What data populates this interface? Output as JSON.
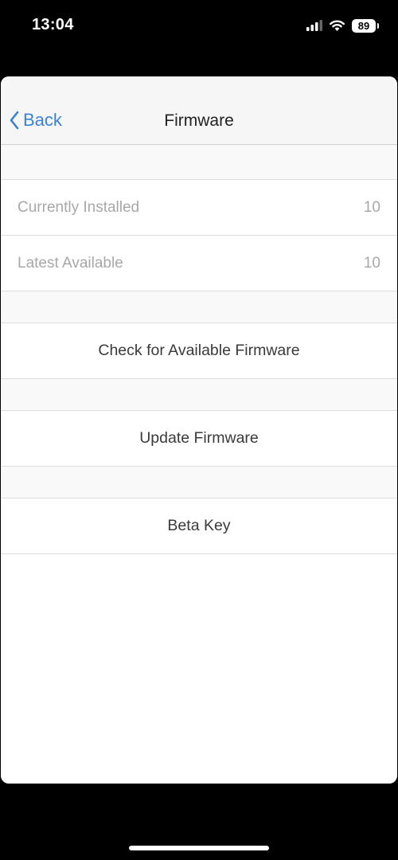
{
  "status_bar": {
    "time": "13:04",
    "battery": "89",
    "icons": [
      "cellular-signal-icon",
      "wifi-icon",
      "battery-icon"
    ]
  },
  "nav": {
    "back_label": "Back",
    "title": "Firmware",
    "back_color": "#3b82d6"
  },
  "info_rows": [
    {
      "label": "Currently Installed",
      "value": "10"
    },
    {
      "label": "Latest Available",
      "value": "10"
    }
  ],
  "actions": {
    "check": "Check for Available Firmware",
    "update": "Update Firmware",
    "beta": "Beta Key"
  }
}
